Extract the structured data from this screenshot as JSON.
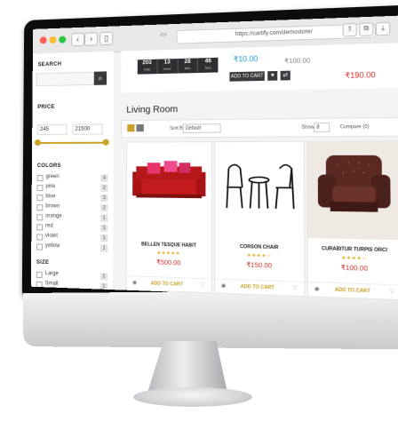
{
  "browser": {
    "url": "https://cartify.com/demostore/",
    "back_icon": "chevron-left-icon",
    "forward_icon": "chevron-right-icon"
  },
  "sidebar": {
    "search_title": "SEARCH",
    "price_title": "PRICE",
    "price_min": "245",
    "price_max": "21500",
    "colors_title": "COLORS",
    "colors": [
      {
        "label": "green",
        "count": "4"
      },
      {
        "label": "pink",
        "count": "2"
      },
      {
        "label": "blue",
        "count": "3"
      },
      {
        "label": "brown",
        "count": "2"
      },
      {
        "label": "orange",
        "count": "1"
      },
      {
        "label": "red",
        "count": "1"
      },
      {
        "label": "violet",
        "count": "1"
      },
      {
        "label": "yellow",
        "count": "1"
      }
    ],
    "size_title": "SIZE",
    "sizes": [
      {
        "label": "Large",
        "count": "1"
      },
      {
        "label": "Small",
        "count": "1"
      }
    ]
  },
  "deal": {
    "countdown": [
      {
        "n": "203",
        "l": "Day"
      },
      {
        "n": "13",
        "l": "Hour"
      },
      {
        "n": "28",
        "l": "Min"
      },
      {
        "n": "46",
        "l": "Sec"
      }
    ],
    "price_new": "₹10.00",
    "price_old": "₹100.00",
    "price_sale": "₹190.00",
    "add_to_cart": "ADD TO CART"
  },
  "category": {
    "title": "Living Room",
    "sort_label": "Sort By",
    "sort_value": "Default",
    "show_label": "Show",
    "show_value": "8",
    "compare_label": "Compare (0)"
  },
  "products": [
    {
      "name": "BELLEN TESQUE HABIT",
      "stars": "★★★★★",
      "price": "₹500.00",
      "add": "ADD TO CART"
    },
    {
      "name": "CORSON CHAIR",
      "stars": "★★★★☆",
      "price": "₹150.00",
      "add": "ADD TO CART"
    },
    {
      "name": "CURABITUR TURPIS ORCI",
      "stars": "★★★★☆",
      "price": "₹100.00",
      "add": "ADD TO CART"
    }
  ],
  "colors": {
    "accent": "#c9a227",
    "sale": "#d0312d",
    "price_blue": "#1e9bd7",
    "dark": "#3b3b3f"
  }
}
